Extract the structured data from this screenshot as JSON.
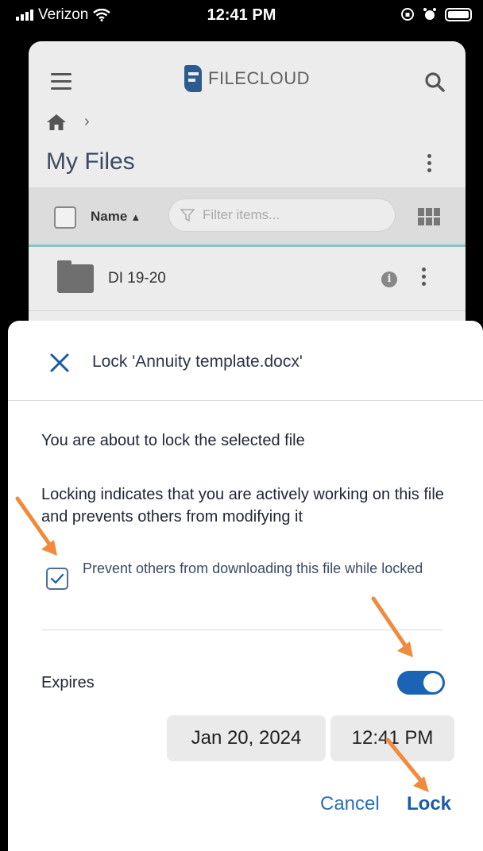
{
  "status_bar": {
    "carrier": "Verizon",
    "time": "12:41 PM"
  },
  "app": {
    "logo_text": "FILECLOUD",
    "page_title": "My Files",
    "sort_label": "Name",
    "filter_placeholder": "Filter items...",
    "rows": [
      {
        "name": "DI 19-20"
      }
    ]
  },
  "dialog": {
    "title": "Lock 'Annuity template.docx'",
    "heading": "You are about to lock the selected file",
    "description": "Locking indicates that you are actively working on this file and prevents others from modifying it",
    "checkbox_label": "Prevent others from downloading this file while locked",
    "checkbox_checked": true,
    "expires_label": "Expires",
    "expires_enabled": true,
    "date_value": "Jan 20, 2024",
    "time_value": "12:41 PM",
    "cancel_label": "Cancel",
    "lock_label": "Lock"
  },
  "colors": {
    "accent": "#1b63b5",
    "annotation_arrow": "#f08a3c",
    "toolbar_underline": "#86c5c0"
  }
}
